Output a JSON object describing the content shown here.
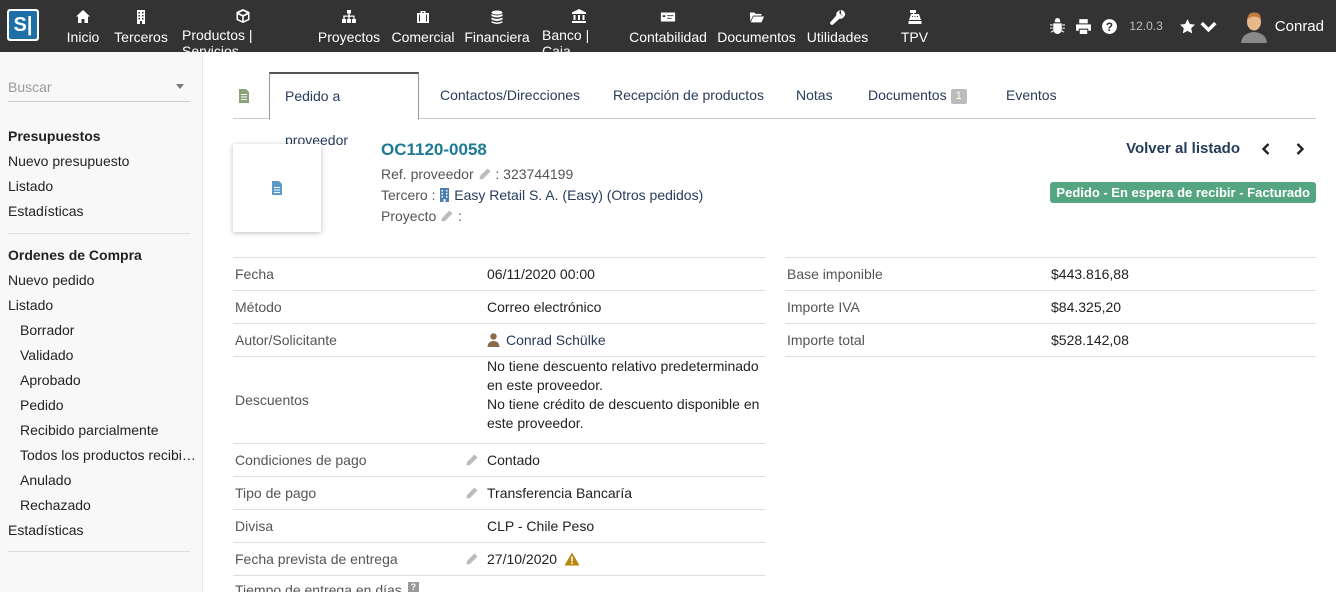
{
  "topbar": {
    "logo_text": "S|",
    "menu": [
      {
        "label": "Inicio",
        "icon": "home-icon"
      },
      {
        "label": "Terceros",
        "icon": "building-icon"
      },
      {
        "label": "Productos | Servicios",
        "icon": "cube-icon"
      },
      {
        "label": "Proyectos",
        "icon": "sitemap-icon"
      },
      {
        "label": "Comercial",
        "icon": "suitcase-icon"
      },
      {
        "label": "Financiera",
        "icon": "coins-icon"
      },
      {
        "label": "Banco | Caja",
        "icon": "bank-icon"
      },
      {
        "label": "Contabilidad",
        "icon": "money-check-icon"
      },
      {
        "label": "Documentos",
        "icon": "folder-icon"
      },
      {
        "label": "Utilidades",
        "icon": "wrench-icon"
      },
      {
        "label": "TPV",
        "icon": "cash-register-icon"
      }
    ],
    "version": "12.0.3",
    "username": "Conrad",
    "colors": {
      "bar": "#333333",
      "text": "#ffffff"
    }
  },
  "sidebar": {
    "search_placeholder": "Buscar",
    "presupuestos": {
      "title": "Presupuestos",
      "items": [
        "Nuevo presupuesto",
        "Listado",
        "Estadísticas"
      ]
    },
    "ordenes": {
      "title": "Ordenes de Compra",
      "items": [
        "Nuevo pedido",
        "Listado"
      ],
      "sub_items": [
        "Borrador",
        "Validado",
        "Aprobado",
        "Pedido",
        "Recibido parcialmente",
        "Todos los productos recibidos",
        "Anulado",
        "Rechazado"
      ],
      "last": "Estadísticas"
    }
  },
  "tabs": {
    "items": [
      "Pedido a proveedor",
      "Contactos/Direcciones",
      "Recepción de productos",
      "Notas",
      "Documentos",
      "Eventos"
    ],
    "documents_count": "1",
    "active": "Pedido a proveedor"
  },
  "order": {
    "ref": "OC1120-0058",
    "supplier_ref_label": "Ref. proveedor",
    "supplier_ref": "323744199",
    "third_party_label": "Tercero :",
    "third_party": "Easy Retail S. A. (Easy)",
    "other_orders": "(Otros pedidos)",
    "project_label": "Proyecto",
    "back_label": "Volver al listado",
    "status": "Pedido - En espera de recibir - Facturado",
    "status_color": "#55a580"
  },
  "fields_left": [
    {
      "label": "Fecha",
      "value": "06/11/2020 00:00"
    },
    {
      "label": "Método",
      "value": "Correo electrónico"
    },
    {
      "label": "Autor/Solicitante",
      "value": "Conrad Schülke"
    },
    {
      "label": "Descuentos",
      "value_lines": [
        "No tiene descuento relativo predeterminado",
        "en este proveedor.",
        "No tiene crédito de descuento disponible en",
        "este proveedor."
      ]
    },
    {
      "label": "Condiciones de pago",
      "value": "Contado"
    },
    {
      "label": "Tipo de pago",
      "value": "Transferencia Bancaría"
    },
    {
      "label": "Divisa",
      "value": "CLP - Chile Peso"
    },
    {
      "label": "Fecha prevista de entrega",
      "value": "27/10/2020"
    },
    {
      "label": "Tiempo de entrega en días",
      "value": ""
    }
  ],
  "fields_right": [
    {
      "label": "Base imponible",
      "value": "$443.816,88"
    },
    {
      "label": "Importe IVA",
      "value": "$84.325,20"
    },
    {
      "label": "Importe total",
      "value": "$528.142,08"
    }
  ]
}
